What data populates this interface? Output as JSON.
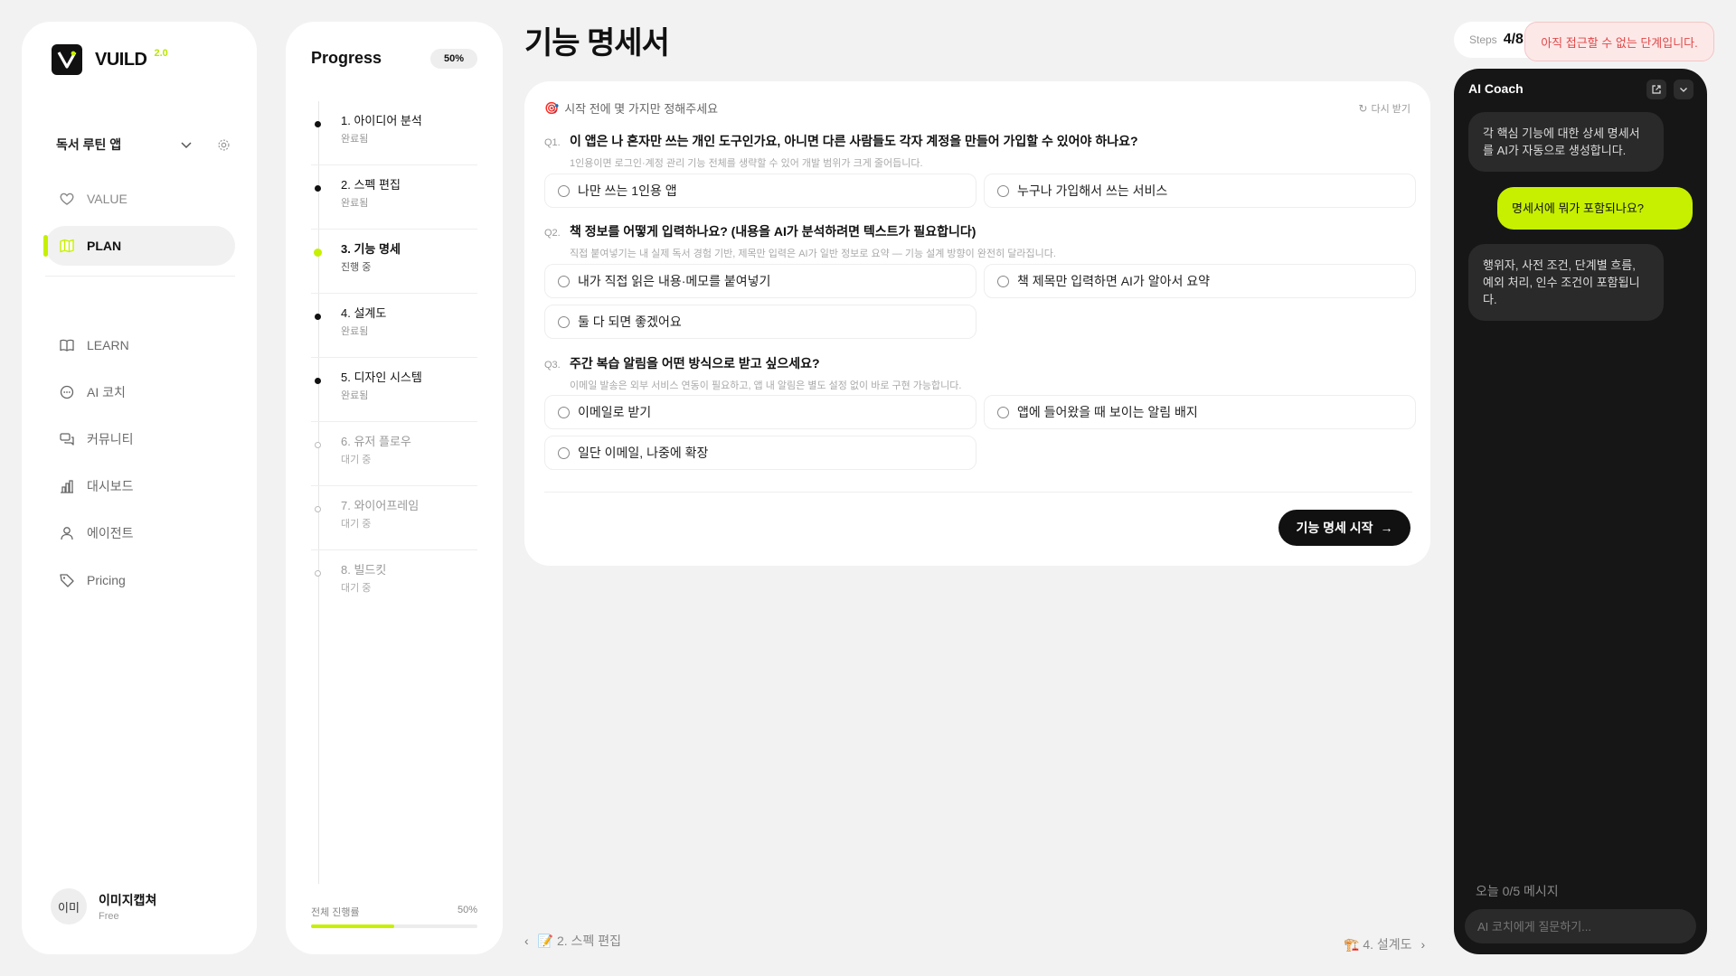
{
  "brand": {
    "name": "VUILD",
    "version": "2.0"
  },
  "sidebar": {
    "project": "독서 루틴 앱",
    "nav_primary": [
      {
        "label": "VALUE",
        "icon": "heart-icon",
        "active": false
      },
      {
        "label": "PLAN",
        "icon": "map-icon",
        "active": true
      }
    ],
    "nav_secondary": [
      {
        "label": "LEARN",
        "icon": "book-icon"
      },
      {
        "label": "AI 코치",
        "icon": "chat-icon"
      },
      {
        "label": "커뮤니티",
        "icon": "community-icon"
      },
      {
        "label": "대시보드",
        "icon": "bar-chart-icon"
      },
      {
        "label": "에이전트",
        "icon": "person-icon"
      },
      {
        "label": "Pricing",
        "icon": "tag-icon"
      }
    ],
    "user": {
      "avatar": "이미",
      "name": "이미지캡쳐",
      "plan": "Free"
    }
  },
  "progress": {
    "title": "Progress",
    "badge": "50%",
    "percent": 50,
    "steps": [
      {
        "label": "1. 아이디어 분석",
        "status": "완료됨",
        "state": "done"
      },
      {
        "label": "2. 스펙 편집",
        "status": "완료됨",
        "state": "done"
      },
      {
        "label": "3. 기능 명세",
        "status": "진행 중",
        "state": "current"
      },
      {
        "label": "4. 설계도",
        "status": "완료됨",
        "state": "done"
      },
      {
        "label": "5. 디자인 시스템",
        "status": "완료됨",
        "state": "done"
      },
      {
        "label": "6. 유저 플로우",
        "status": "대기 중",
        "state": "pending"
      },
      {
        "label": "7. 와이어프레임",
        "status": "대기 중",
        "state": "pending"
      },
      {
        "label": "8. 빌드킷",
        "status": "대기 중",
        "state": "pending"
      }
    ],
    "footer_label": "전체 진행률",
    "footer_value": "50%"
  },
  "main": {
    "title": "기능 명세서",
    "card": {
      "header_emoji": "🎯",
      "header": "시작 전에 몇 가지만 정해주세요",
      "regen": "다시 받기",
      "questions": [
        {
          "num": "Q1.",
          "text": "이 앱은 나 혼자만 쓰는 개인 도구인가요, 아니면 다른 사람들도 각자 계정을 만들어 가입할 수 있어야 하나요?",
          "hint": "1인용이면 로그인·계정 관리 기능 전체를 생략할 수 있어 개발 범위가 크게 줄어듭니다.",
          "options": [
            "나만 쓰는 1인용 앱",
            "누구나 가입해서 쓰는 서비스"
          ]
        },
        {
          "num": "Q2.",
          "text": "책 정보를 어떻게 입력하나요? (내용을 AI가 분석하려면 텍스트가 필요합니다)",
          "hint": "직접 붙여넣기는 내 실제 독서 경험 기반, 제목만 입력은 AI가 일반 정보로 요약 — 기능 설계 방향이 완전히 달라집니다.",
          "options": [
            "내가 직접 읽은 내용·메모를 붙여넣기",
            "책 제목만 입력하면 AI가 알아서 요약",
            "둘 다 되면 좋겠어요"
          ]
        },
        {
          "num": "Q3.",
          "text": "주간 복습 알림을 어떤 방식으로 받고 싶으세요?",
          "hint": "이메일 발송은 외부 서비스 연동이 필요하고, 앱 내 알림은 별도 설정 없이 바로 구현 가능합니다.",
          "options": [
            "이메일로 받기",
            "앱에 들어왔을 때 보이는 알림 배지",
            "일단 이메일, 나중에 확장"
          ]
        }
      ],
      "start_button": "기능 명세 시작"
    },
    "prev": "📝 2. 스펙 편집",
    "next": "🏗️ 4. 설계도"
  },
  "steps_pill": {
    "label": "Steps",
    "value": "4/8"
  },
  "toast": "아직 접근할 수 없는 단계입니다.",
  "coach": {
    "title": "AI Coach",
    "messages": [
      {
        "role": "ai",
        "text": "각 핵심 기능에 대한 상세 명세서를 AI가 자동으로 생성합니다."
      },
      {
        "role": "user",
        "text": "명세서에 뭐가 포함되나요?"
      },
      {
        "role": "ai",
        "text": "행위자, 사전 조건, 단계별 흐름, 예외 처리, 인수 조건이 포함됩니다."
      }
    ],
    "quota": "오늘 0/5 메시지",
    "input_placeholder": "AI 코치에게 질문하기..."
  },
  "colors": {
    "accent": "#c6f000",
    "dark": "#161616",
    "toast_text": "#e04848"
  }
}
